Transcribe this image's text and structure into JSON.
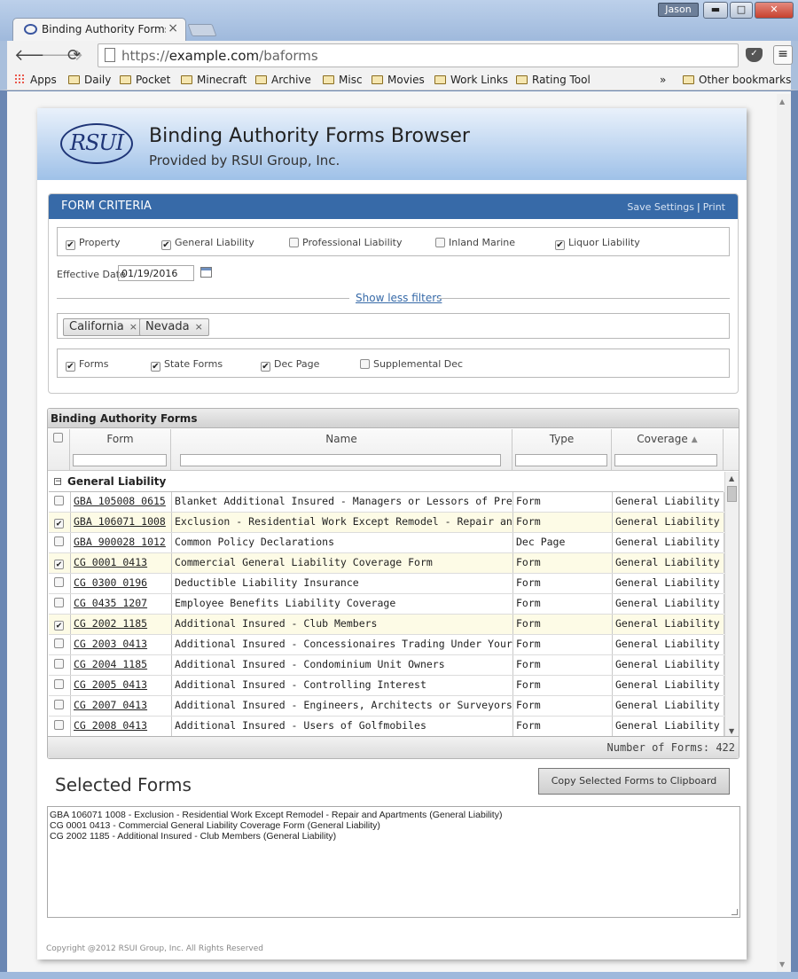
{
  "window": {
    "user": "Jason",
    "min": "▬",
    "max": "□",
    "close": "✕"
  },
  "tab": {
    "title": "Binding Authority Forms B",
    "close": "×"
  },
  "toolbar": {
    "url_prefix": "https://",
    "url_host": "example.com",
    "url_path": "/baforms"
  },
  "bookmarks": {
    "apps": "Apps",
    "items": [
      "Daily",
      "Pocket",
      "Minecraft",
      "Archive",
      "Misc",
      "Movies",
      "Work Links",
      "Rating Tool"
    ],
    "overflow": "»",
    "other": "Other bookmarks"
  },
  "header": {
    "logo": "RSUI",
    "title": "Binding Authority Forms Browser",
    "subtitle": "Provided by RSUI Group, Inc."
  },
  "criteria": {
    "title": "FORM CRITERIA",
    "save": "Save Settings",
    "sep": "|",
    "print": "Print",
    "coverages": [
      {
        "label": "Property",
        "checked": true
      },
      {
        "label": "General Liability",
        "checked": true
      },
      {
        "label": "Professional Liability",
        "checked": false
      },
      {
        "label": "Inland Marine",
        "checked": false
      },
      {
        "label": "Liquor Liability",
        "checked": true
      }
    ],
    "effective_label": "Effective Date",
    "effective_value": "01/19/2016",
    "toggle_filters": "Show less filters",
    "states": [
      "California",
      "Nevada"
    ],
    "remove": "×",
    "types": [
      {
        "label": "Forms",
        "checked": true
      },
      {
        "label": "State Forms",
        "checked": true
      },
      {
        "label": "Dec Page",
        "checked": true
      },
      {
        "label": "Supplemental Dec",
        "checked": false
      }
    ]
  },
  "grid": {
    "caption": "Binding Authority Forms",
    "columns": [
      "Form",
      "Name",
      "Type",
      "Coverage"
    ],
    "sort_indicator": "▲",
    "group": {
      "toggle": "−",
      "label": "General Liability"
    },
    "rows": [
      {
        "form": "GBA 105008 0615",
        "name": "Blanket Additional Insured - Managers or Lessors of Premises",
        "type": "Form",
        "coverage": "General Liability",
        "checked": false
      },
      {
        "form": "GBA 106071 1008",
        "name": "Exclusion - Residential Work Except Remodel - Repair and Apartments",
        "type": "Form",
        "coverage": "General Liability",
        "checked": true
      },
      {
        "form": "GBA 900028 1012",
        "name": "Common Policy Declarations",
        "type": "Dec Page",
        "coverage": "General Liability",
        "checked": false
      },
      {
        "form": "CG 0001 0413",
        "name": "Commercial General Liability Coverage Form",
        "type": "Form",
        "coverage": "General Liability",
        "checked": true
      },
      {
        "form": "CG 0300 0196",
        "name": "Deductible Liability Insurance",
        "type": "Form",
        "coverage": "General Liability",
        "checked": false
      },
      {
        "form": "CG 0435 1207",
        "name": "Employee Benefits Liability Coverage",
        "type": "Form",
        "coverage": "General Liability",
        "checked": false
      },
      {
        "form": "CG 2002 1185",
        "name": "Additional Insured - Club Members",
        "type": "Form",
        "coverage": "General Liability",
        "checked": true
      },
      {
        "form": "CG 2003 0413",
        "name": "Additional Insured - Concessionaires Trading Under Your Name",
        "type": "Form",
        "coverage": "General Liability",
        "checked": false
      },
      {
        "form": "CG 2004 1185",
        "name": "Additional Insured - Condominium Unit Owners",
        "type": "Form",
        "coverage": "General Liability",
        "checked": false
      },
      {
        "form": "CG 2005 0413",
        "name": "Additional Insured - Controlling Interest",
        "type": "Form",
        "coverage": "General Liability",
        "checked": false
      },
      {
        "form": "CG 2007 0413",
        "name": "Additional Insured - Engineers, Architects or Surveyors",
        "type": "Form",
        "coverage": "General Liability",
        "checked": false
      },
      {
        "form": "CG 2008 0413",
        "name": "Additional Insured - Users of Golfmobiles",
        "type": "Form",
        "coverage": "General Liability",
        "checked": false
      }
    ],
    "count_label": "Number of Forms: 422"
  },
  "selected": {
    "title": "Selected Forms",
    "copy_button": "Copy Selected Forms to Clipboard",
    "text": "GBA 106071 1008 - Exclusion - Residential Work Except Remodel - Repair and Apartments (General Liability)\nCG 0001 0413 - Commercial General Liability Coverage Form (General Liability)\nCG 2002 1185 - Additional Insured - Club Members (General Liability)"
  },
  "footer": {
    "copyright": "Copyright @2012 RSUI Group, Inc. All Rights Reserved"
  }
}
